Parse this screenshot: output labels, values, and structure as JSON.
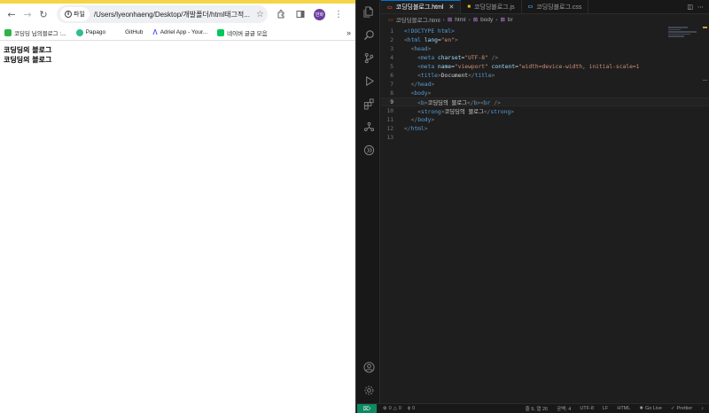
{
  "browser": {
    "site_info_label": "파일",
    "url": "/Users/lyeonhaeng/Desktop/개발폴더/html태그적...",
    "profile_label": "만화",
    "bookmarks": [
      {
        "label": "코딩딩 님의블로그 :...",
        "color": "#2fb344"
      },
      {
        "label": "Papago",
        "color": "#2ebd8c"
      },
      {
        "label": "GitHub",
        "color": "#ffffff"
      },
      {
        "label": "Adriel App - Your...",
        "color": "#4b5dff"
      },
      {
        "label": "네이버 글글 모음",
        "color": "#03c75a"
      }
    ],
    "page_lines": [
      "코딩딩의 블로그",
      "코딩딩의 블로그"
    ]
  },
  "vscode": {
    "tabs": [
      {
        "label": "코딩딩블로그.html",
        "icon": "html-file-icon",
        "active": true
      },
      {
        "label": "코딩딩블로그.js",
        "icon": "js-file-icon",
        "active": false
      },
      {
        "label": "코딩딩블로그.css",
        "icon": "css-file-icon",
        "active": false
      }
    ],
    "breadcrumb": [
      "코딩딩블로그.html",
      "html",
      "body",
      "br"
    ],
    "code_lines": [
      {
        "n": "1",
        "segments": [
          {
            "c": "t-doc",
            "t": "<!DOCTYPE html>"
          }
        ]
      },
      {
        "n": "2",
        "segments": [
          {
            "c": "t-br",
            "t": "<"
          },
          {
            "c": "t-tag",
            "t": "html"
          },
          {
            "c": "t-attr",
            "t": " lang"
          },
          {
            "c": "t-text",
            "t": "="
          },
          {
            "c": "t-str",
            "t": "\"en\""
          },
          {
            "c": "t-br",
            "t": ">"
          }
        ]
      },
      {
        "n": "3",
        "segments": [
          {
            "c": "t-text",
            "t": "  "
          },
          {
            "c": "t-br",
            "t": "<"
          },
          {
            "c": "t-tag",
            "t": "head"
          },
          {
            "c": "t-br",
            "t": ">"
          }
        ]
      },
      {
        "n": "4",
        "segments": [
          {
            "c": "t-text",
            "t": "    "
          },
          {
            "c": "t-br",
            "t": "<"
          },
          {
            "c": "t-tag",
            "t": "meta"
          },
          {
            "c": "t-attr",
            "t": " charset"
          },
          {
            "c": "t-text",
            "t": "="
          },
          {
            "c": "t-str",
            "t": "\"UTF-8\""
          },
          {
            "c": "t-br",
            "t": " />"
          }
        ]
      },
      {
        "n": "5",
        "segments": [
          {
            "c": "t-text",
            "t": "    "
          },
          {
            "c": "t-br",
            "t": "<"
          },
          {
            "c": "t-tag",
            "t": "meta"
          },
          {
            "c": "t-attr",
            "t": " name"
          },
          {
            "c": "t-text",
            "t": "="
          },
          {
            "c": "t-str",
            "t": "\"viewport\""
          },
          {
            "c": "t-attr",
            "t": " content"
          },
          {
            "c": "t-text",
            "t": "="
          },
          {
            "c": "t-str",
            "t": "\"width=device-width, initial-scale=1"
          }
        ]
      },
      {
        "n": "6",
        "segments": [
          {
            "c": "t-text",
            "t": "    "
          },
          {
            "c": "t-br",
            "t": "<"
          },
          {
            "c": "t-tag",
            "t": "title"
          },
          {
            "c": "t-br",
            "t": ">"
          },
          {
            "c": "t-text",
            "t": "Document"
          },
          {
            "c": "t-br",
            "t": "</"
          },
          {
            "c": "t-tag",
            "t": "title"
          },
          {
            "c": "t-br",
            "t": ">"
          }
        ]
      },
      {
        "n": "7",
        "segments": [
          {
            "c": "t-text",
            "t": "  "
          },
          {
            "c": "t-br",
            "t": "</"
          },
          {
            "c": "t-tag",
            "t": "head"
          },
          {
            "c": "t-br",
            "t": ">"
          }
        ]
      },
      {
        "n": "8",
        "segments": [
          {
            "c": "t-text",
            "t": "  "
          },
          {
            "c": "t-br",
            "t": "<"
          },
          {
            "c": "t-tag",
            "t": "body"
          },
          {
            "c": "t-br",
            "t": ">"
          }
        ]
      },
      {
        "n": "9",
        "segments": [
          {
            "c": "t-text",
            "t": "    "
          },
          {
            "c": "t-br",
            "t": "<"
          },
          {
            "c": "t-tag",
            "t": "b"
          },
          {
            "c": "t-br",
            "t": ">"
          },
          {
            "c": "t-text",
            "t": "코딩딩의 블로그"
          },
          {
            "c": "t-br",
            "t": "</"
          },
          {
            "c": "t-tag",
            "t": "b"
          },
          {
            "c": "t-br",
            "t": "><"
          },
          {
            "c": "t-tag",
            "t": "br"
          },
          {
            "c": "t-br",
            "t": " />"
          }
        ],
        "current": true
      },
      {
        "n": "10",
        "segments": [
          {
            "c": "t-text",
            "t": "    "
          },
          {
            "c": "t-br",
            "t": "<"
          },
          {
            "c": "t-tag",
            "t": "strong"
          },
          {
            "c": "t-br",
            "t": ">"
          },
          {
            "c": "t-text",
            "t": "코딩딩의 블로그"
          },
          {
            "c": "t-br",
            "t": "</"
          },
          {
            "c": "t-tag",
            "t": "strong"
          },
          {
            "c": "t-br",
            "t": ">"
          }
        ]
      },
      {
        "n": "11",
        "segments": [
          {
            "c": "t-text",
            "t": "  "
          },
          {
            "c": "t-br",
            "t": "</"
          },
          {
            "c": "t-tag",
            "t": "body"
          },
          {
            "c": "t-br",
            "t": ">"
          }
        ]
      },
      {
        "n": "12",
        "segments": [
          {
            "c": "t-br",
            "t": "</"
          },
          {
            "c": "t-tag",
            "t": "html"
          },
          {
            "c": "t-br",
            "t": ">"
          }
        ]
      },
      {
        "n": "13",
        "segments": []
      }
    ],
    "status": {
      "errors": "0",
      "warnings": "0",
      "ports": "0",
      "cursor": "줄 9, 열 26",
      "spaces": "공백: 4",
      "encoding": "UTF-8",
      "eol": "LF",
      "language": "HTML",
      "golive": "Go Live",
      "prettier": "Prettier"
    }
  }
}
